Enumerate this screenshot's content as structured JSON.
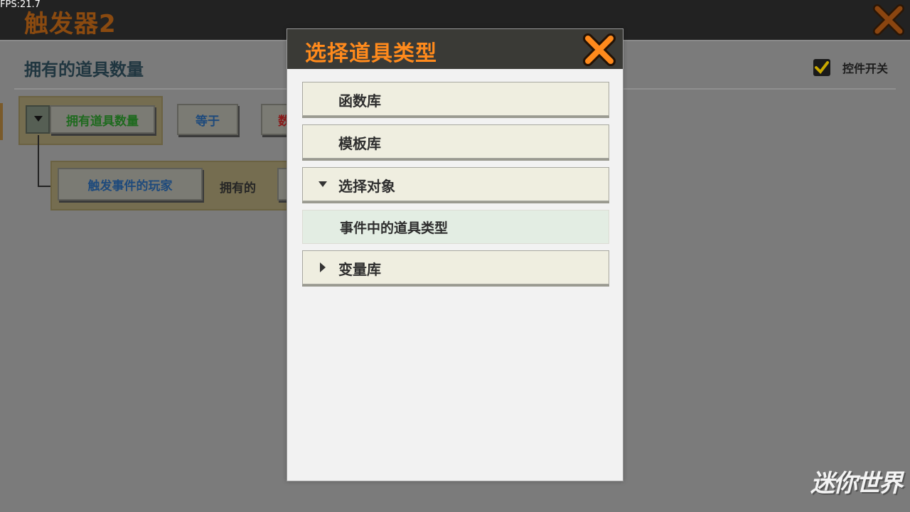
{
  "fps": "FPS:21.7",
  "app": {
    "title": "触发器2"
  },
  "condition": {
    "title": "拥有的道具数量",
    "toggle_label": "控件开关",
    "toggle_checked": true,
    "row1": {
      "dropdown_label": "拥有道具数量",
      "compare_label": "等于",
      "value_partial": "数"
    },
    "row2": {
      "player_label": "触发事件的玩家",
      "text": "拥有的"
    }
  },
  "modal": {
    "title": "选择道具类型",
    "items": [
      {
        "label": "函数库",
        "arrow": "none"
      },
      {
        "label": "模板库",
        "arrow": "none"
      },
      {
        "label": "选择对象",
        "arrow": "down"
      },
      {
        "label": "事件中的道具类型",
        "sub": true
      },
      {
        "label": "变量库",
        "arrow": "right"
      }
    ]
  },
  "watermark": "迷你世界",
  "colors": {
    "accent": "#ff8a1c",
    "dropdown_text": "#1f8a1f",
    "compare_text": "#1e5a8c",
    "value_text": "#b02020",
    "player_text": "#1e5a8c",
    "checkbox_check": "#e8c000"
  }
}
